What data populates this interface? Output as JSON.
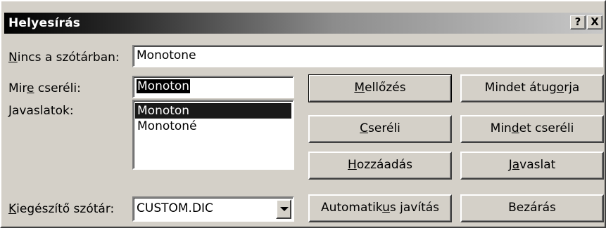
{
  "window": {
    "title": "Helyesírás",
    "help_button": "?",
    "close_button": "X"
  },
  "labels": {
    "not_in_dict_pre": "",
    "not_in_dict_hot": "N",
    "not_in_dict_post": "incs a szótárban:",
    "change_to_pre": "Mir",
    "change_to_hot": "e",
    "change_to_post": " cseréli:",
    "suggestions": "Javaslatok:",
    "custom_dict_pre": "",
    "custom_dict_hot": "K",
    "custom_dict_post": "iegészítő szótár:"
  },
  "fields": {
    "not_in_dict_value": "Monotone",
    "change_to_value": "Monoton",
    "custom_dict_value": "CUSTOM.DIC"
  },
  "suggestions": [
    {
      "text": "Monoton",
      "selected": true
    },
    {
      "text": "Monotoné",
      "selected": false
    }
  ],
  "buttons": {
    "ignore": {
      "pre": "",
      "hot": "M",
      "post": "ellőzés"
    },
    "ignore_all": {
      "pre": "Mindet átug",
      "hot": "o",
      "post": "rja"
    },
    "change": {
      "pre": "",
      "hot": "C",
      "post": "seréli"
    },
    "change_all": {
      "pre": "Min",
      "hot": "d",
      "post": "et cseréli"
    },
    "add": {
      "pre": "",
      "hot": "H",
      "post": "ozzáadás"
    },
    "suggest": {
      "pre": "J",
      "hot": "a",
      "post": "vaslat"
    },
    "autocorrect": {
      "pre": "Automatik",
      "hot": "u",
      "post": "s javítás"
    },
    "close": {
      "pre": "Bezárás",
      "hot": "",
      "post": ""
    }
  },
  "icons": {
    "dropdown": "chevron-down-icon"
  }
}
